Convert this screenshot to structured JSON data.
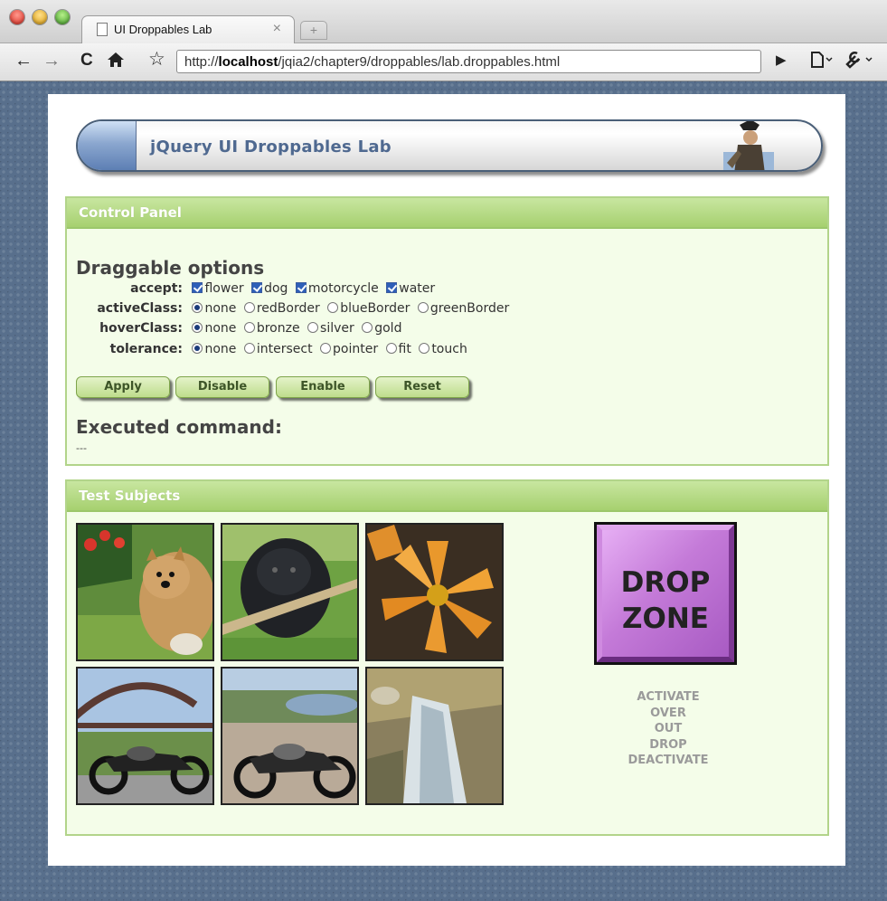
{
  "browser": {
    "tab_title": "UI Droppables Lab",
    "tab_close": "×",
    "new_tab": "+",
    "url_prefix": "http://",
    "url_host": "localhost",
    "url_path": "/jqia2/chapter9/droppables/lab.droppables.html"
  },
  "header": {
    "title": "jQuery UI Droppables Lab"
  },
  "control_panel": {
    "title": "Control Panel",
    "section_title": "Draggable options",
    "accept": {
      "label": "accept:",
      "options": [
        {
          "label": "flower",
          "checked": true
        },
        {
          "label": "dog",
          "checked": true
        },
        {
          "label": "motorcycle",
          "checked": true
        },
        {
          "label": "water",
          "checked": true
        }
      ]
    },
    "activeClass": {
      "label": "activeClass:",
      "options": [
        "none",
        "redBorder",
        "blueBorder",
        "greenBorder"
      ],
      "selected": "none"
    },
    "hoverClass": {
      "label": "hoverClass:",
      "options": [
        "none",
        "bronze",
        "silver",
        "gold"
      ],
      "selected": "none"
    },
    "tolerance": {
      "label": "tolerance:",
      "options": [
        "none",
        "intersect",
        "pointer",
        "fit",
        "touch"
      ],
      "selected": "none"
    },
    "buttons": [
      "Apply",
      "Disable",
      "Enable",
      "Reset"
    ],
    "executed_title": "Executed command:",
    "executed_value": "---"
  },
  "test_subjects": {
    "title": "Test Subjects",
    "images": [
      "dog",
      "dog",
      "flower",
      "motorcycle",
      "motorcycle",
      "water"
    ],
    "drop_zone": [
      "DROP",
      "ZONE"
    ],
    "events": [
      "ACTIVATE",
      "OVER",
      "OUT",
      "DROP",
      "DEACTIVATE"
    ]
  }
}
